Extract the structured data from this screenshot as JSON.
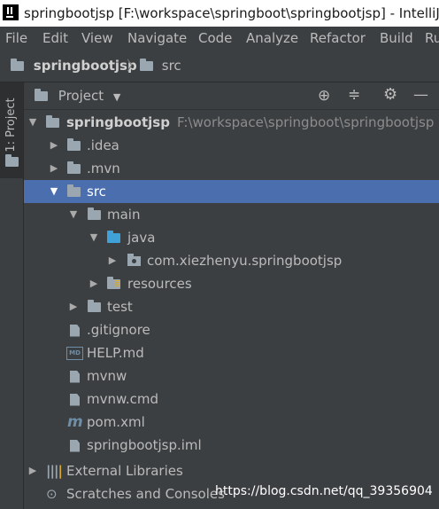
{
  "window": {
    "title": "springbootjsp [F:\\workspace\\springboot\\springbootjsp] - IntelliJ"
  },
  "menu": [
    "File",
    "Edit",
    "View",
    "Navigate",
    "Code",
    "Analyze",
    "Refactor",
    "Build",
    "Ru"
  ],
  "breadcrumb": {
    "project": "springbootjsp",
    "folder": "src"
  },
  "sidebar_tab": {
    "label": "1: Project"
  },
  "panel": {
    "title": "Project"
  },
  "tree": {
    "root": {
      "name": "springbootjsp",
      "path": "F:\\workspace\\springboot\\springbootjsp"
    },
    "idea": ".idea",
    "mvn": ".mvn",
    "src": "src",
    "main": "main",
    "java": "java",
    "package": "com.xiezhenyu.springbootjsp",
    "resources": "resources",
    "test": "test",
    "gitignore": ".gitignore",
    "help": "HELP.md",
    "md_badge": "MD",
    "mvnw": "mvnw",
    "mvnw_cmd": "mvnw.cmd",
    "pom": "pom.xml",
    "iml": "springbootjsp.iml",
    "ext_libs": "External Libraries",
    "scratches": "Scratches and Consoles"
  },
  "watermark": "https://blog.csdn.net/qq_39356904"
}
